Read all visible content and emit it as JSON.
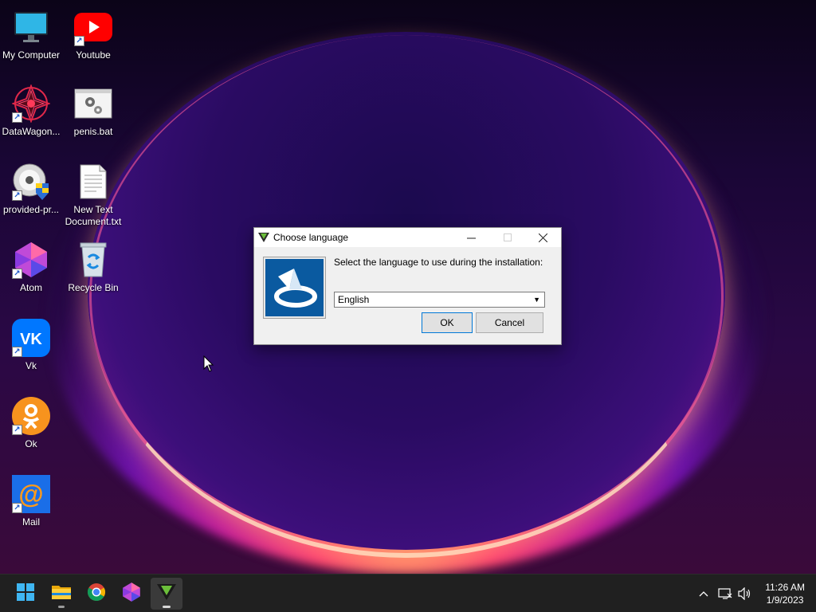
{
  "desktop": {
    "icons": [
      {
        "label": "My Computer",
        "icon": "monitor-icon",
        "shortcut": false
      },
      {
        "label": "Youtube",
        "icon": "youtube-icon",
        "shortcut": true
      },
      {
        "label": "DataWagon...",
        "icon": "datawagon-icon",
        "shortcut": true
      },
      {
        "label": "penis.bat",
        "icon": "batch-file-gear-icon",
        "shortcut": false
      },
      {
        "label": "provided-pr...",
        "icon": "installer-disc-shield-icon",
        "shortcut": true
      },
      {
        "label": "New Text Document.txt",
        "icon": "text-document-icon",
        "shortcut": false
      },
      {
        "label": "Atom",
        "icon": "atom-editor-icon",
        "shortcut": true
      },
      {
        "label": "Recycle Bin",
        "icon": "recycle-bin-icon",
        "shortcut": false
      },
      {
        "label": "Vk",
        "icon": "vk-icon",
        "shortcut": true
      },
      {
        "label": "Ok",
        "icon": "odnoklassniki-icon",
        "shortcut": true
      },
      {
        "label": "Mail",
        "icon": "mail-at-icon",
        "shortcut": true
      }
    ]
  },
  "dialog": {
    "title": "Choose language",
    "prompt": "Select the language to use during the installation:",
    "language_select": {
      "value": "English"
    },
    "ok_label": "OK",
    "cancel_label": "Cancel",
    "minimize_glyph": "—",
    "maximize_glyph": "☐",
    "close_glyph": "✕"
  },
  "taskbar": {
    "items": [
      {
        "name": "start-button",
        "icon": "windows-logo-icon"
      },
      {
        "name": "file-explorer",
        "icon": "folder-icon",
        "running": true
      },
      {
        "name": "chrome",
        "icon": "chrome-icon"
      },
      {
        "name": "atom",
        "icon": "atom-editor-icon"
      },
      {
        "name": "setup",
        "icon": "setup-v-icon",
        "running": true,
        "active": true
      }
    ],
    "tray": {
      "overflow_glyph": "^",
      "time": "11:26 AM",
      "date": "1/9/2023"
    }
  },
  "colors": {
    "accent": "#0078d7",
    "taskbar_bg": "#202020",
    "dialog_body": "#f0f0f0",
    "logo_blue": "#0a5aa0"
  }
}
